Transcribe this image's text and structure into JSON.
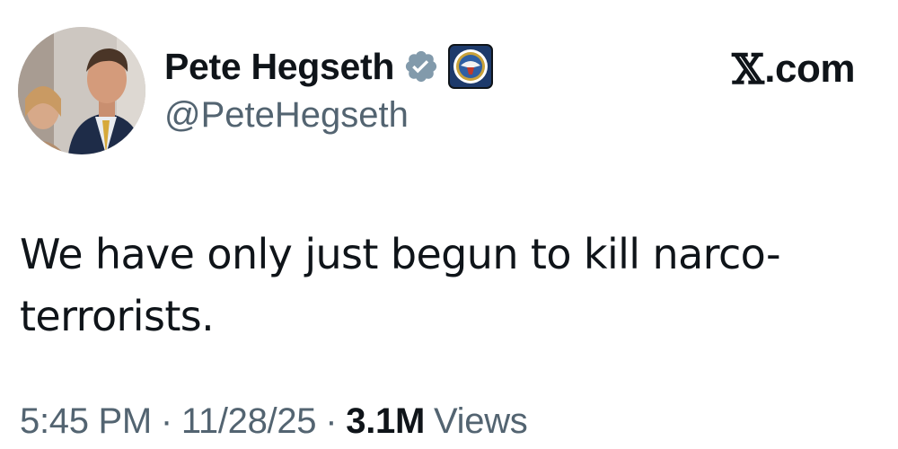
{
  "post": {
    "author": {
      "display_name": "Pete Hegseth",
      "handle": "@PeteHegseth",
      "avatar_icon": "profile-photo",
      "verified_icon": "verified-badge-icon",
      "affiliate_icon": "department-seal-icon"
    },
    "brand": {
      "logo_text": "𝕏",
      "domain_suffix": ".com"
    },
    "text_lines": [
      "We have only just begun to kill narco-",
      "terrorists."
    ],
    "time": "5:45 PM",
    "date": "11/28/25",
    "separator": "·",
    "views_count": "3.1M",
    "views_label": "Views"
  },
  "colors": {
    "primary_text": "#0f1419",
    "secondary_text": "#536471",
    "verified_badge": "#829aab",
    "seal_navy": "#1d3a6b",
    "background": "#ffffff"
  }
}
